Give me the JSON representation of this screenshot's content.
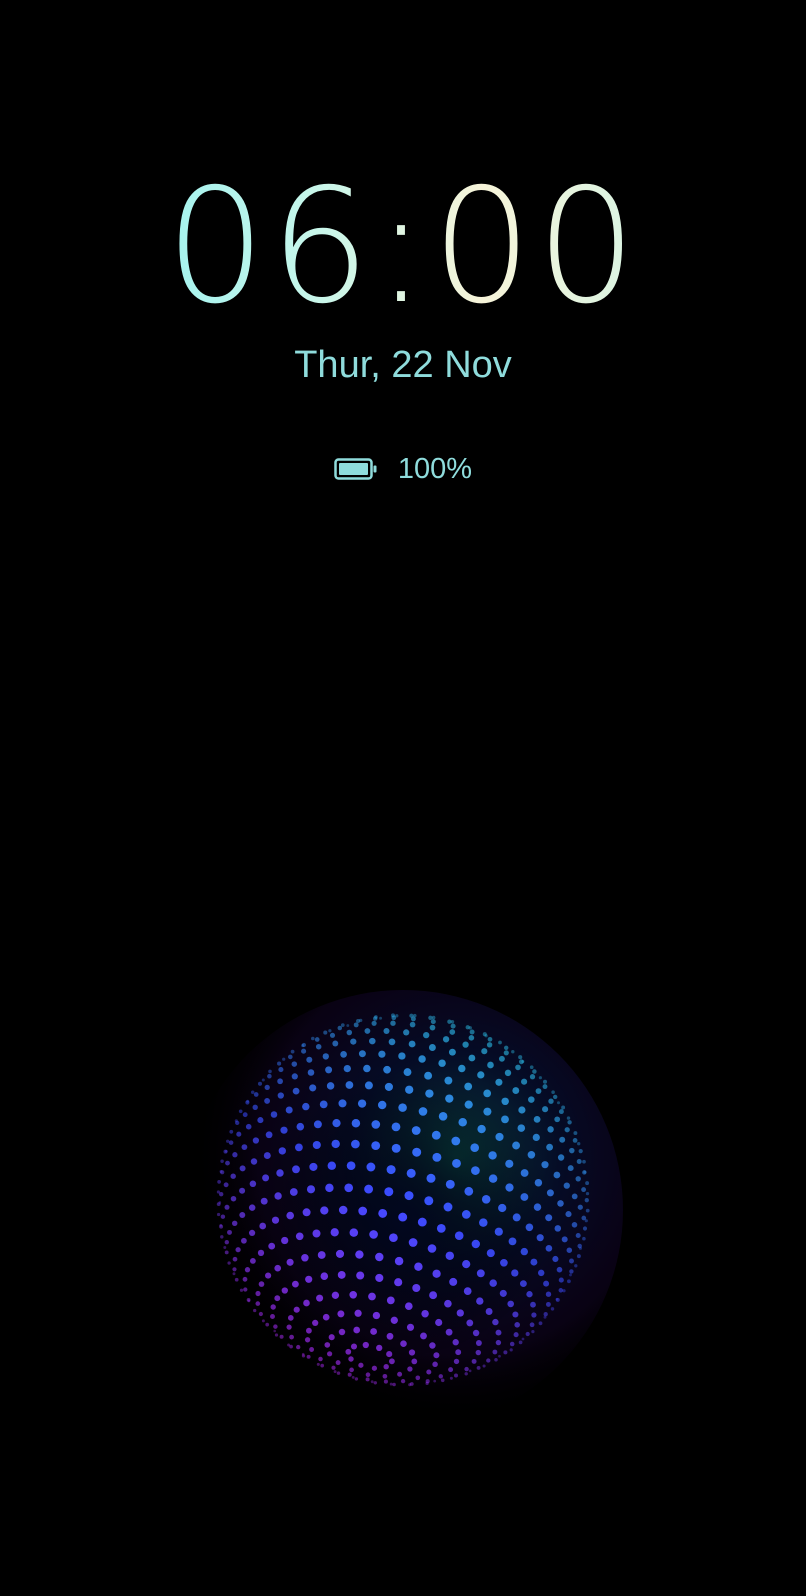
{
  "lockscreen": {
    "time": "06:00",
    "date": "Thur, 22 Nov",
    "battery": {
      "icon": "battery-full-icon",
      "percent_label": "100%",
      "level": 1.0
    }
  },
  "colors": {
    "background": "#000000",
    "text_accent": "#8fdcdc",
    "orb_cyan": "#27f0e6",
    "orb_blue": "#3a4cff",
    "orb_magenta": "#d21cf0"
  }
}
